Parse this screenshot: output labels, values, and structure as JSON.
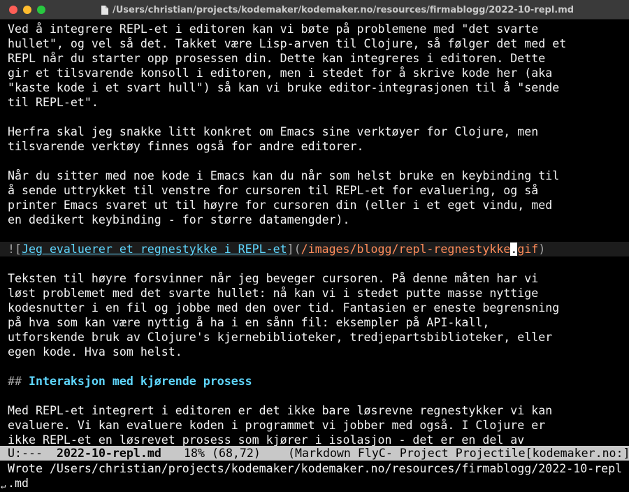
{
  "window": {
    "title": "/Users/christian/projects/kodemaker/kodemaker.no/resources/firmablogg/2022-10-repl.md",
    "title_icon": "document-icon"
  },
  "buffer": {
    "p1": [
      "Ved å integrere REPL-et i editoren kan vi bøte på problemene med \"det svarte",
      "hullet\", og vel så det. Takket være Lisp-arven til Clojure, så følger det med et",
      "REPL når du starter opp prosessen din. Dette kan integreres i editoren. Dette",
      "gir et tilsvarende konsoll i editoren, men i stedet for å skrive kode her (aka",
      "\"kaste kode i et svart hull\") så kan vi bruke editor-integrasjonen til å \"sende",
      "til REPL-et\"."
    ],
    "p2": [
      "Herfra skal jeg snakke litt konkret om Emacs sine verktøyer for Clojure, men",
      "tilsvarende verktøy finnes også for andre editorer."
    ],
    "p3": [
      "Når du sitter med noe kode i Emacs kan du når som helst bruke en keybinding til",
      "å sende uttrykket til venstre for cursoren til REPL-et for evaluering, og så",
      "printer Emacs svaret ut til høyre for cursoren din (eller i et eget vindu, med",
      "en dedikert keybinding - for større datamengder)."
    ],
    "image_line": {
      "bang_open": "![",
      "alt": "Jeg evaluerer et regnestykke i REPL-et",
      "close_open": "](",
      "path_before": "/images/blogg/repl-regnestykke",
      "cursor_char": ".",
      "path_after": "gif",
      "close": ")"
    },
    "p4": [
      "Teksten til høyre forsvinner når jeg beveger cursoren. På denne måten har vi",
      "løst problemet med det svarte hullet: nå kan vi i stedet putte masse nyttige",
      "kodesnutter i en fil og jobbe med den over tid. Fantasien er eneste begrensning",
      "på hva som kan være nyttig å ha i en sånn fil: eksempler på API-kall,",
      "utforskende bruk av Clojure's kjernebiblioteker, tredjepartsbiblioteker, eller",
      "egen kode. Hva som helst."
    ],
    "heading": {
      "marker": "##",
      "text": "Interaksjon med kjørende prosess"
    },
    "p5": [
      "Med REPL-et integrert i editoren er det ikke bare løsrevne regnestykker vi kan",
      "evaluere. Vi kan evaluere koden i programmet vi jobber med også. I Clojure er",
      "ikke REPL-et en løsrevet prosess som kjører i isolasjon - det er en del av"
    ]
  },
  "modeline": {
    "status": "U:---",
    "buffer_name": "2022-10-repl.md",
    "position": "18% (68,72)",
    "modes": "(Markdown FlyC- Project Projectile[kodemaker.no:]"
  },
  "minibuffer": {
    "line1": "Wrote /Users/christian/projects/kodemaker/kodemaker.no/resources/firmablogg/2022-10-repl",
    "line2": ".md",
    "wrap_glyph": "↵"
  },
  "colors": {
    "background": "#000000",
    "text": "#f2f2f2",
    "link": "#5fd7ff",
    "url": "#ff8c5a",
    "modeline_bg": "#c8c8c8"
  }
}
